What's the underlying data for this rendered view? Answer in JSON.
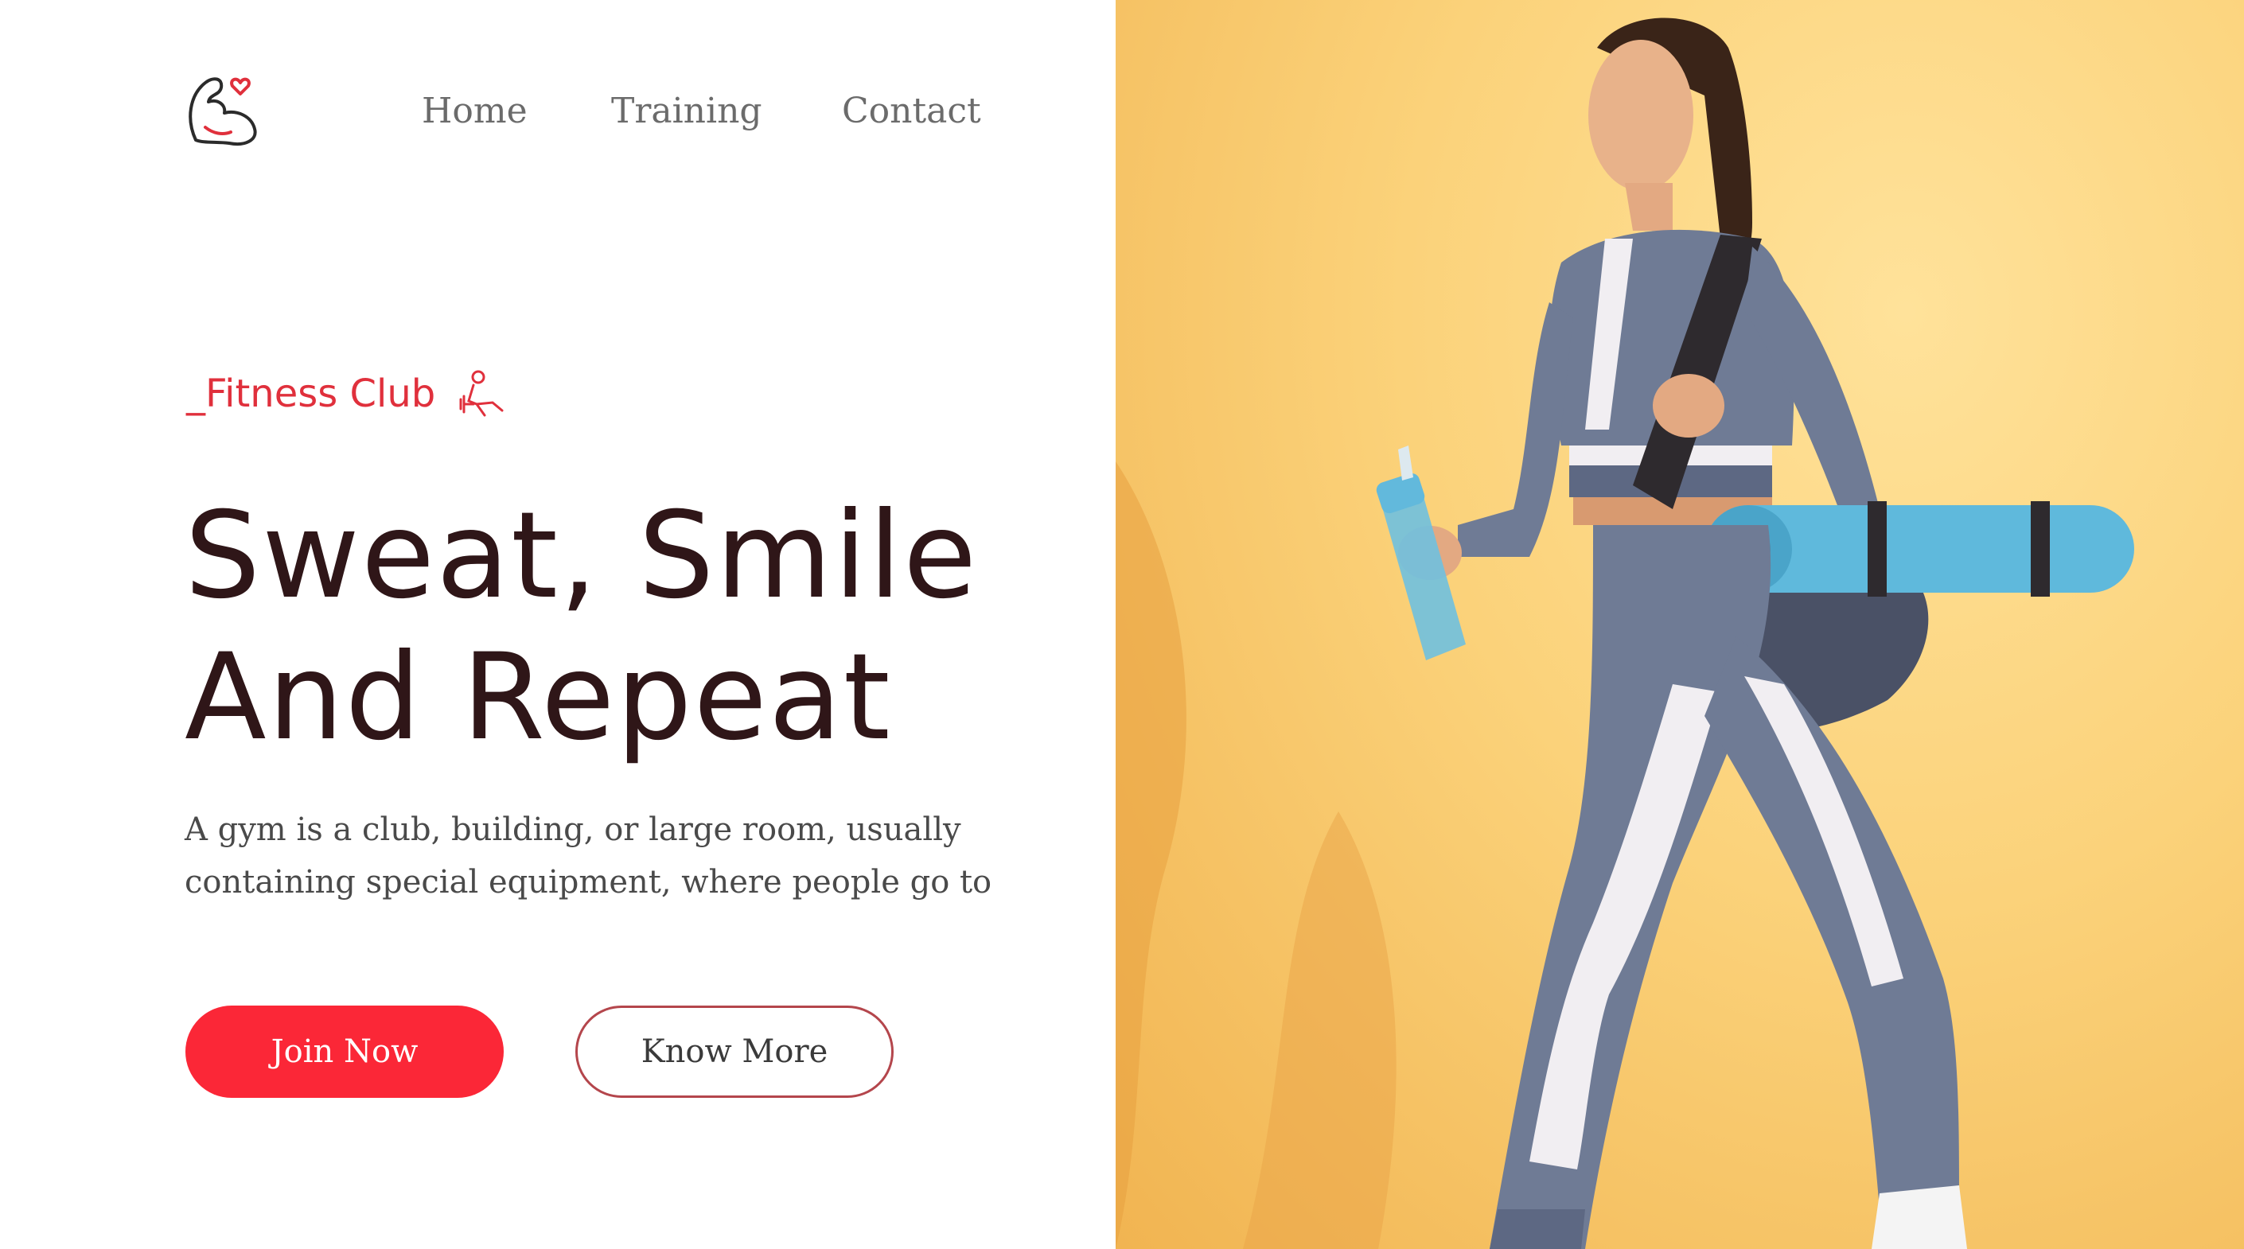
{
  "nav": {
    "items": [
      {
        "label": "Home"
      },
      {
        "label": "Training"
      },
      {
        "label": "Contact"
      }
    ]
  },
  "hero": {
    "eyebrow": "_Fitness Club",
    "headline_line1": "Sweat, Smile",
    "headline_line2": "And Repeat",
    "description_line1": "A gym is a club, building, or large room, usually",
    "description_line2": "containing special equipment, where people go to",
    "join_label": "Join Now",
    "more_label": "Know More",
    "image_subject": "woman in sportswear carrying a yoga mat bag and a water bottle"
  },
  "icons": {
    "logo": "flexed-arm-heart-icon",
    "eyebrow": "dumbbell-lifter-icon"
  },
  "colors": {
    "accent": "#fb2737",
    "headline": "#2f1618",
    "nav_text": "#6b6b6b",
    "hero_background": "#fbd27a"
  }
}
